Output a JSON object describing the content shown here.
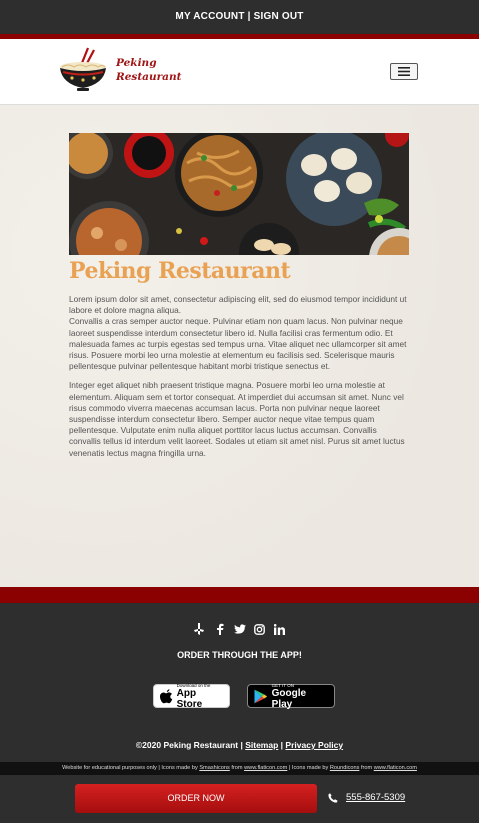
{
  "topbar": {
    "my_account": "MY ACCOUNT",
    "separator": "|",
    "sign_out": "SIGN OUT"
  },
  "header": {
    "logo_text_line1": "Peking",
    "logo_text_line2": "Restaurant",
    "menu_icon": "hamburger-icon"
  },
  "main": {
    "hero_alt": "chinese-food-spread",
    "title": "Peking Restaurant",
    "paragraph1": "Lorem ipsum dolor sit amet, consectetur adipiscing elit, sed do eiusmod tempor incididunt ut labore et dolore magna aliqua.",
    "paragraph1b": "Convallis a cras semper auctor neque. Pulvinar etiam non quam lacus. Non pulvinar neque laoreet suspendisse interdum consectetur libero id. Nulla facilisi cras fermentum odio. Et malesuada fames ac turpis egestas sed tempus urna. Vitae aliquet nec ullamcorper sit amet risus. Posuere morbi leo urna molestie at elementum eu facilisis sed. Scelerisque mauris pellentesque pulvinar pellentesque habitant morbi tristique senectus et.",
    "paragraph2": "Integer eget aliquet nibh praesent tristique magna. Posuere morbi leo urna molestie at elementum. Aliquam sem et tortor consequat. At imperdiet dui accumsan sit amet. Nunc vel risus commodo viverra maecenas accumsan lacus. Porta non pulvinar neque laoreet suspendisse interdum consectetur libero. Semper auctor neque vitae tempus quam pellentesque. Vulputate enim nulla aliquet porttitor lacus luctus accumsan. Convallis convallis tellus id interdum velit laoreet. Sodales ut etiam sit amet nisl. Purus sit amet luctus venenatis lectus magna fringilla urna."
  },
  "footer": {
    "social_icons": [
      "yelp-icon",
      "facebook-icon",
      "twitter-icon",
      "instagram-icon",
      "linkedin-icon"
    ],
    "order_app": "ORDER THROUGH THE APP!",
    "app_store_small": "Download on the",
    "app_store_big": "App Store",
    "google_play_small": "GET IT ON",
    "google_play_big": "Google Play",
    "copyright": "©2020 Peking Restaurant |",
    "sitemap": "Sitemap",
    "pipe": "|",
    "privacy": "Privacy Policy"
  },
  "credits": {
    "prefix": "Website for educational purposes only | Icons made by",
    "author1": "Smashicons",
    "from1": "from",
    "site1": "www.flaticon.com",
    "mid": "| Icons made by",
    "author2": "Roundicons",
    "from2": "from",
    "site2": "www.flaticon.com"
  },
  "bottombar": {
    "order_now": "ORDER NOW",
    "phone": "555-867-5309"
  },
  "colors": {
    "accent": "#8b0000",
    "title": "#e9a254",
    "dark": "#2e2e2e",
    "order_button": "#c01818"
  }
}
